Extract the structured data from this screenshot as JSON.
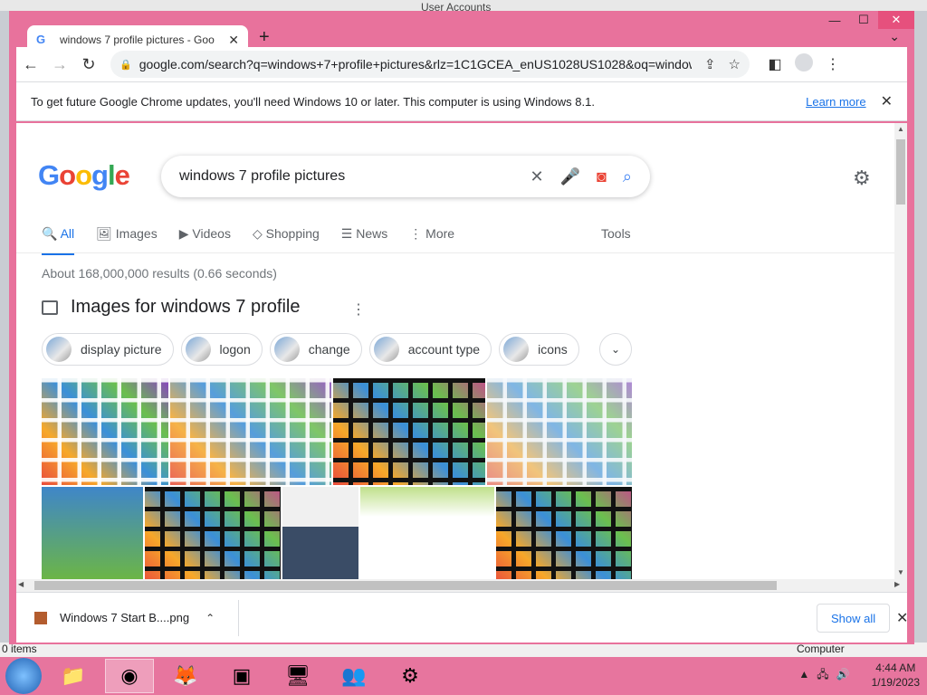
{
  "background": {
    "title": "User Accounts",
    "status_left": "0 items",
    "status_right": "Computer"
  },
  "window_controls": {
    "minimize": "—",
    "maximize": "☐",
    "close": "✕"
  },
  "tab": {
    "title": "windows 7 profile pictures - Goo",
    "close": "✕",
    "new_tab": "+",
    "tab_search": "⌄"
  },
  "toolbar": {
    "back": "←",
    "forward": "→",
    "reload": "↻",
    "url": "google.com/search?q=windows+7+profile+pictures&rlz=1C1GCEA_enUS1028US1028&oq=windows+7+p..."
  },
  "infobar": {
    "message": "To get future Google Chrome updates, you'll need Windows 10 or later. This computer is using Windows 8.1.",
    "link": "Learn more",
    "close": "✕"
  },
  "search": {
    "query": "windows 7 profile pictures",
    "clear": "✕"
  },
  "search_tabs": [
    {
      "label": "All",
      "icon": "🔍",
      "active": true
    },
    {
      "label": "Images",
      "icon": "🖼"
    },
    {
      "label": "Videos",
      "icon": "▶"
    },
    {
      "label": "Shopping",
      "icon": "◇"
    },
    {
      "label": "News",
      "icon": "☰"
    },
    {
      "label": "More",
      "icon": "⋮"
    }
  ],
  "tools_label": "Tools",
  "stats": "About 168,000,000 results (0.66 seconds)",
  "images_title": "Images for windows 7 profile",
  "chips": [
    "display picture",
    "logon",
    "change",
    "account type",
    "icons"
  ],
  "downloads": {
    "file": "Windows 7 Start B....png",
    "show_all": "Show all",
    "close": "✕"
  },
  "taskbar": {
    "time": "4:44 AM",
    "date": "1/19/2023"
  }
}
